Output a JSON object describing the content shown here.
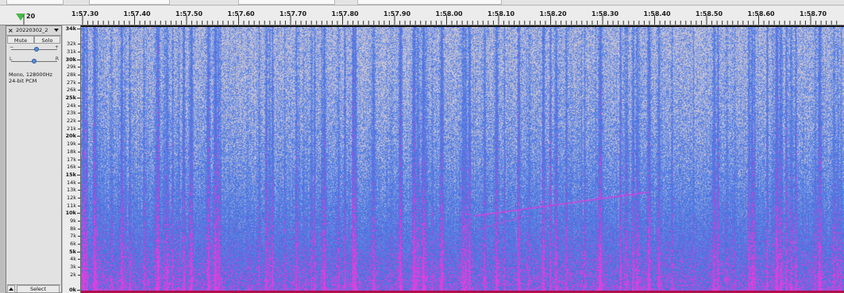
{
  "timeline": {
    "cursor_label": "20",
    "tick_labels": [
      "1:57.30",
      "1:57.40",
      "1:57.50",
      "1:57.60",
      "1:57.70",
      "1:57.80",
      "1:57.90",
      "1:58.00",
      "1:58.10",
      "1:58.20",
      "1:58.30",
      "1:58.40",
      "1:58.50",
      "1:58.60",
      "1:58.70"
    ],
    "tick_seconds": [
      117.3,
      117.4,
      117.5,
      117.6,
      117.7,
      117.8,
      117.9,
      118.0,
      118.1,
      118.2,
      118.3,
      118.4,
      118.5,
      118.6,
      118.7
    ]
  },
  "track": {
    "close_symbol": "×",
    "name": "20220302_2",
    "mute_label": "Mute",
    "solo_label": "Solo",
    "gain_minus": "−",
    "gain_plus": "+",
    "pan_left": "L",
    "pan_right": "R",
    "gain_level": 0.55,
    "pan_level": 0.5,
    "info_line1": "Mono, 128000Hz",
    "info_line2": "24-bit PCM",
    "select_label": "Select"
  },
  "frequency_scale": {
    "min_khz": 0,
    "max_khz": 34,
    "labels": [
      "34k",
      "32k",
      "31k",
      "30k",
      "29k",
      "28k",
      "27k",
      "26k",
      "25k",
      "24k",
      "23k",
      "22k",
      "21k",
      "20k",
      "19k",
      "18k",
      "17k",
      "16k",
      "15k",
      "14k",
      "13k",
      "12k",
      "11k",
      "10k",
      "9k",
      "8k",
      "7k",
      "6k",
      "5k",
      "4k",
      "3k",
      "2k",
      "0k"
    ],
    "khz_values": [
      34,
      32,
      31,
      30,
      29,
      28,
      27,
      26,
      25,
      24,
      23,
      22,
      21,
      20,
      19,
      18,
      17,
      16,
      15,
      14,
      13,
      12,
      11,
      10,
      9,
      8,
      7,
      6,
      5,
      4,
      3,
      2,
      0
    ],
    "bold_khz": [
      34,
      30,
      25,
      20,
      15,
      10,
      5,
      0
    ]
  },
  "colors": {
    "spectrogram_base": "#8aa6dc",
    "spectrogram_light": "#c8c4d4",
    "spectrogram_blue": "#5a82e8",
    "spectrogram_magenta": "#e040e0",
    "accent_green": "#48b848"
  },
  "icons": {
    "playhead": "green-triangle-down",
    "track_menu": "chevron-down-icon",
    "collapse": "triangle-up-icon"
  }
}
